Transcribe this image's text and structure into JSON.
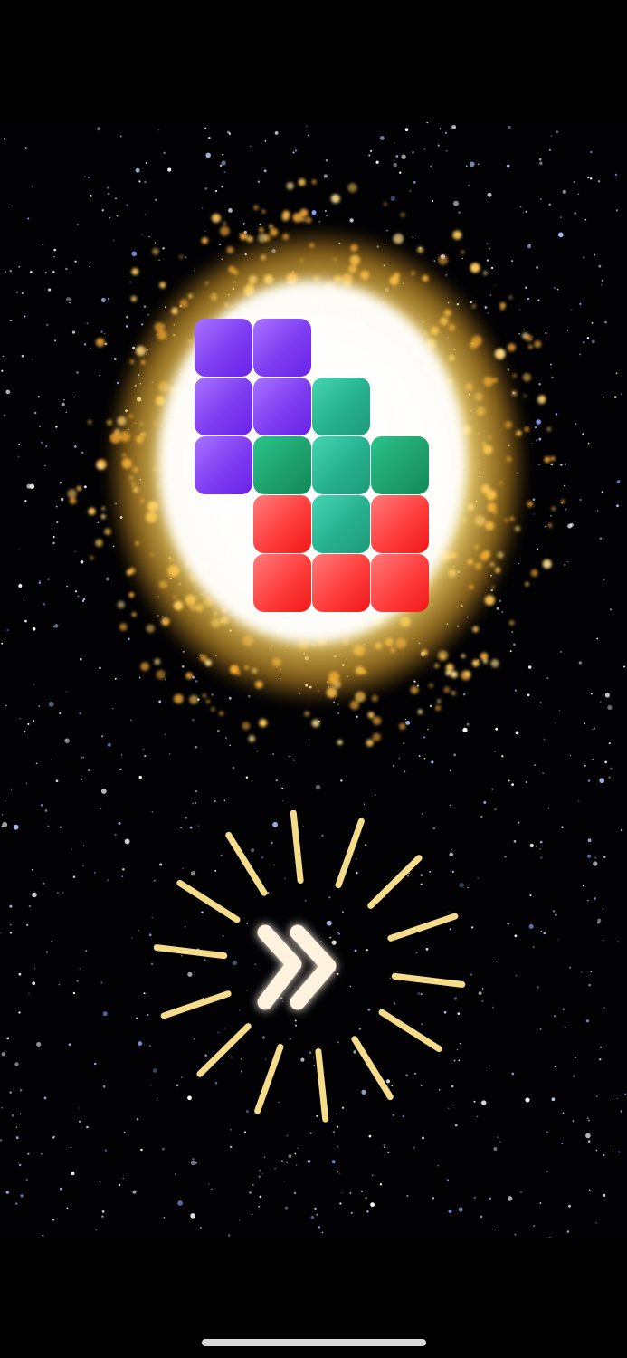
{
  "game": {
    "colors": {
      "background": "#000000",
      "purple_block": "#7e3cf0",
      "teal_block": "#26b08e",
      "green_block": "#1fa06c",
      "red_block": "#ff3d3d",
      "explosion_glow": "#ffd35a",
      "skip_rays": "#f5dc8a",
      "skip_arrow": "#fff3e0"
    },
    "blocks": [
      {
        "color": "purple",
        "row": 0,
        "col": 0
      },
      {
        "color": "purple",
        "row": 0,
        "col": 1
      },
      {
        "color": "purple",
        "row": 1,
        "col": 0
      },
      {
        "color": "purple",
        "row": 1,
        "col": 1
      },
      {
        "color": "teal",
        "row": 1,
        "col": 2
      },
      {
        "color": "purple",
        "row": 2,
        "col": 0
      },
      {
        "color": "green",
        "row": 2,
        "col": 1
      },
      {
        "color": "teal",
        "row": 2,
        "col": 2
      },
      {
        "color": "green",
        "row": 2,
        "col": 3
      },
      {
        "color": "red",
        "row": 3,
        "col": 1
      },
      {
        "color": "teal",
        "row": 3,
        "col": 2
      },
      {
        "color": "red",
        "row": 3,
        "col": 3
      },
      {
        "color": "red",
        "row": 4,
        "col": 1
      },
      {
        "color": "red",
        "row": 4,
        "col": 2
      },
      {
        "color": "red",
        "row": 4,
        "col": 3
      }
    ],
    "skip_button_icon": "double-chevron-right-icon"
  }
}
